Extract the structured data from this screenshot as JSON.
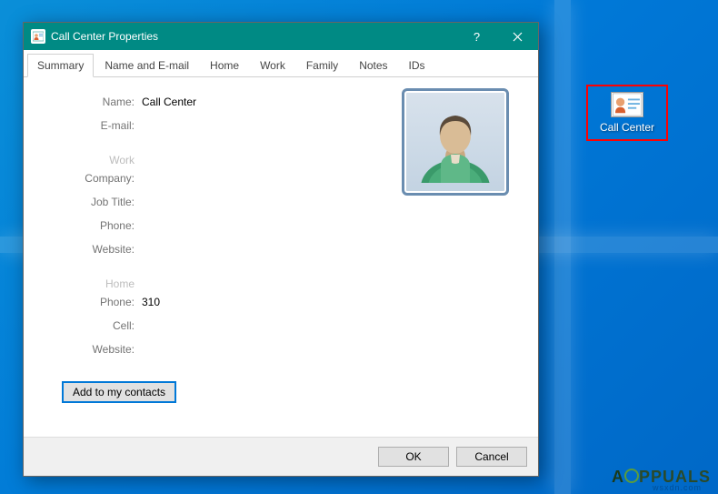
{
  "dialog": {
    "title": "Call Center Properties",
    "help_label": "?",
    "close_label": "✕"
  },
  "tabs": [
    {
      "label": "Summary",
      "active": true
    },
    {
      "label": "Name and E-mail",
      "active": false
    },
    {
      "label": "Home",
      "active": false
    },
    {
      "label": "Work",
      "active": false
    },
    {
      "label": "Family",
      "active": false
    },
    {
      "label": "Notes",
      "active": false
    },
    {
      "label": "IDs",
      "active": false
    }
  ],
  "summary": {
    "name_label": "Name:",
    "name_value": "Call Center",
    "email_label": "E-mail:",
    "email_value": "",
    "work_section": "Work",
    "company_label": "Company:",
    "company_value": "",
    "jobtitle_label": "Job Title:",
    "jobtitle_value": "",
    "phone_work_label": "Phone:",
    "phone_work_value": "",
    "website_work_label": "Website:",
    "website_work_value": "",
    "home_section": "Home",
    "phone_home_label": "Phone:",
    "phone_home_value": "310",
    "cell_label": "Cell:",
    "cell_value": "",
    "website_home_label": "Website:",
    "website_home_value": ""
  },
  "buttons": {
    "add_contacts": "Add to my contacts",
    "ok": "OK",
    "cancel": "Cancel"
  },
  "desktop": {
    "icon_label": "Call Center"
  },
  "watermark": "PPUALS",
  "source_watermark": "wsxdn.com"
}
